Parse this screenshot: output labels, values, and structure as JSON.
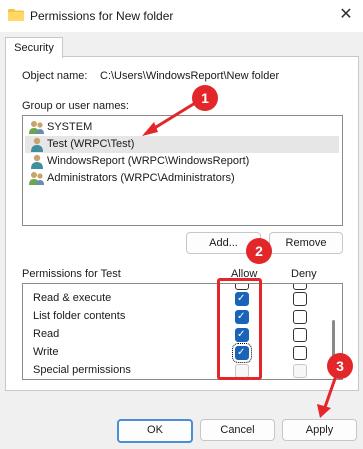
{
  "window": {
    "title": "Permissions for New folder",
    "close_glyph": "✕"
  },
  "tabs": [
    {
      "label": "Security"
    }
  ],
  "object": {
    "label": "Object name:",
    "value": "C:\\Users\\WindowsReport\\New folder"
  },
  "group_users": {
    "label": "Group or user names:",
    "items": [
      {
        "name": "SYSTEM",
        "icon": "users-group-icon",
        "selected": false
      },
      {
        "name": "Test (WRPC\\Test)",
        "icon": "user-icon",
        "selected": true
      },
      {
        "name": "WindowsReport (WRPC\\WindowsReport)",
        "icon": "user-icon",
        "selected": false
      },
      {
        "name": "Administrators (WRPC\\Administrators)",
        "icon": "users-group-icon",
        "selected": false
      }
    ]
  },
  "buttons": {
    "add": "Add...",
    "remove": "Remove",
    "ok": "OK",
    "cancel": "Cancel",
    "apply": "Apply"
  },
  "permissions": {
    "label": "Permissions for Test",
    "allow_header": "Allow",
    "deny_header": "Deny",
    "rows": [
      {
        "name": "Read & execute",
        "allow": true,
        "deny": false
      },
      {
        "name": "List folder contents",
        "allow": true,
        "deny": false
      },
      {
        "name": "Read",
        "allow": true,
        "deny": false
      },
      {
        "name": "Write",
        "allow": true,
        "deny": false
      },
      {
        "name": "Special permissions",
        "allow": false,
        "deny": false
      }
    ]
  },
  "annotations": {
    "badge1": "1",
    "badge2": "2",
    "badge3": "3"
  },
  "colors": {
    "annotation_red": "#e3262a",
    "check_blue": "#1a64b8",
    "focus_blue": "#4a8fd6"
  }
}
